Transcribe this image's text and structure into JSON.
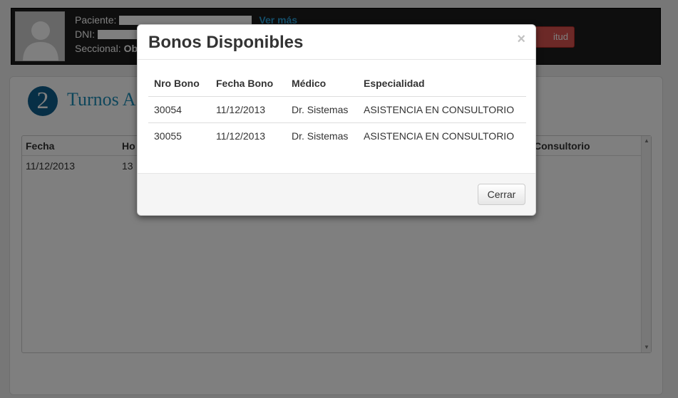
{
  "patient": {
    "paciente_label": "Paciente:",
    "ver_mas": "Ver más",
    "dni_label": "DNI:",
    "seccional_label": "Seccional:",
    "seccional_value": "Ob",
    "action_button": "itud"
  },
  "panel": {
    "step_number": "2",
    "title": "Turnos A"
  },
  "grid": {
    "headers": {
      "fecha": "Fecha",
      "hora": "Ho",
      "consultorio": "Consultorio"
    },
    "rows": [
      {
        "fecha": "11/12/2013",
        "hora": "13",
        "consultorio": ""
      }
    ]
  },
  "modal": {
    "title": "Bonos Disponibles",
    "close": "×",
    "headers": {
      "nro_bono": "Nro Bono",
      "fecha_bono": "Fecha Bono",
      "medico": "Médico",
      "especialidad": "Especialidad"
    },
    "rows": [
      {
        "nro_bono": "30054",
        "fecha_bono": "11/12/2013",
        "medico": "Dr. Sistemas",
        "especialidad": "ASISTENCIA EN CONSULTORIO"
      },
      {
        "nro_bono": "30055",
        "fecha_bono": "11/12/2013",
        "medico": "Dr. Sistemas",
        "especialidad": "ASISTENCIA EN CONSULTORIO"
      }
    ],
    "cerrar_label": "Cerrar"
  },
  "colors": {
    "accent": "#1d8db7",
    "danger": "#d9534f",
    "header_bg": "#1d1d1d",
    "link": "#2a9fd6"
  },
  "icons": {
    "avatar": "person-silhouette-icon",
    "close": "close-icon",
    "scroll_up": "chevron-up-icon",
    "scroll_down": "chevron-down-icon"
  }
}
